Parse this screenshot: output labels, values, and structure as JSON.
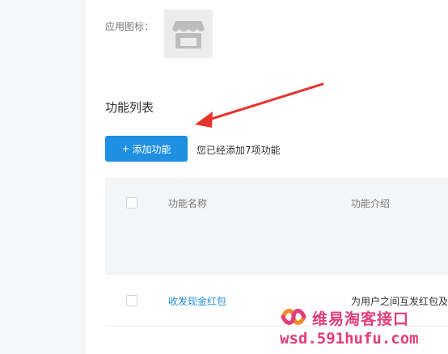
{
  "app_icon": {
    "label": "应用图标：",
    "icon": "store-icon"
  },
  "functions": {
    "title": "功能列表",
    "add_button_label": "添加功能",
    "add_button_icon": "plus-icon",
    "added_count_text": "您已经添加7项功能"
  },
  "table": {
    "headers": [
      "功能名称",
      "功能介绍"
    ],
    "rows": [
      {
        "name": "收发现金红包",
        "description": "为用户之间互发红包及"
      }
    ]
  },
  "watermark": {
    "title": "维易淘客接口",
    "url": "wsd.591hufu.com",
    "logo_icon": "brand-logo-icon"
  },
  "colors": {
    "accent": "#1e8fe1",
    "annotation_arrow": "#e8322d",
    "watermark": "#e23d7a"
  }
}
